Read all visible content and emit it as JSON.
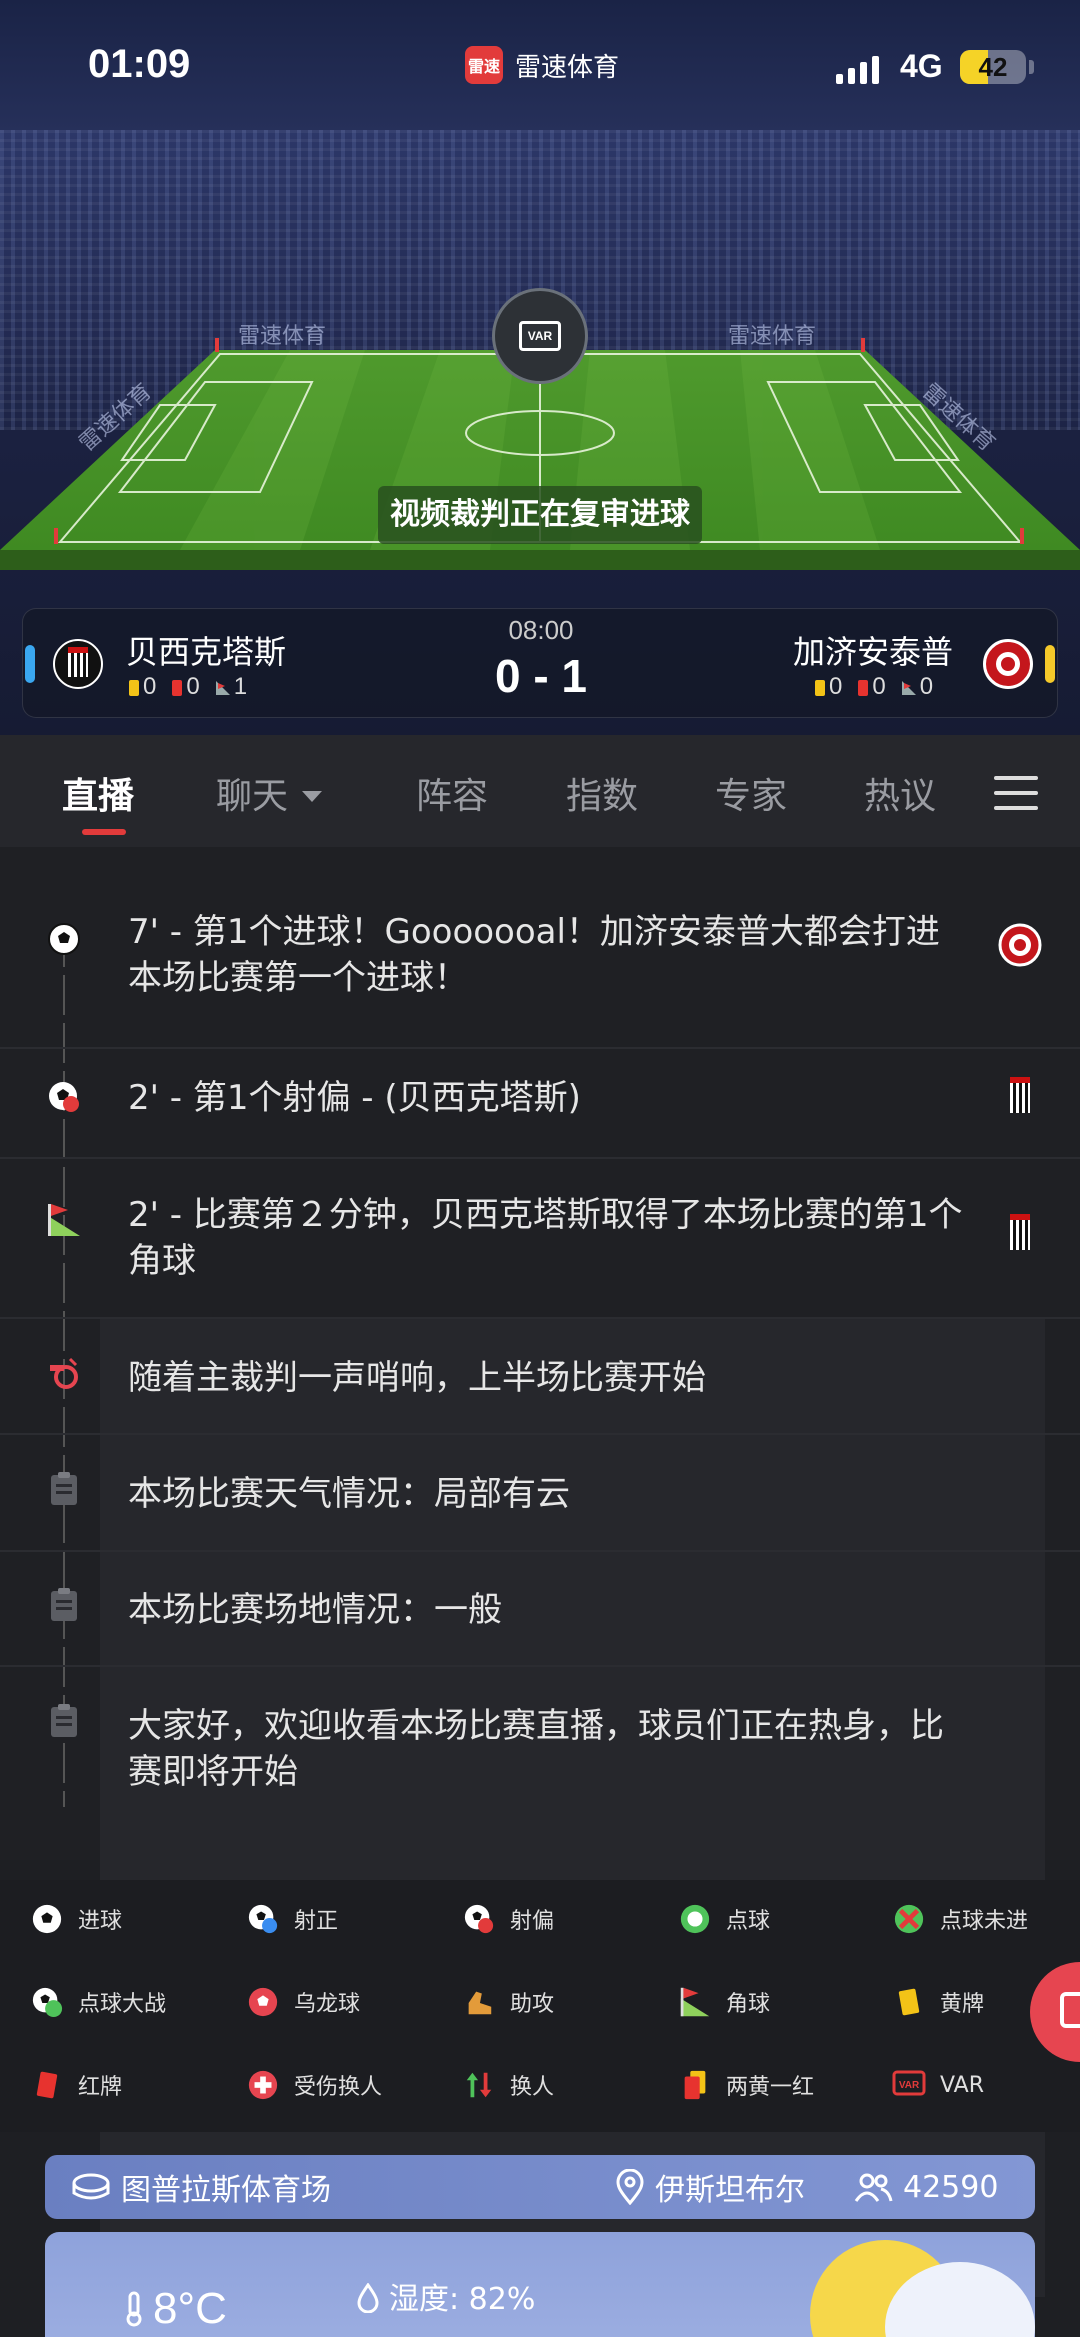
{
  "status": {
    "time": "01:09",
    "app_name": "雷速体育",
    "app_logo": "雷速",
    "network": "4G",
    "battery": "42",
    "battery_level": 0.42
  },
  "stadium": {
    "ad_boards": [
      "雷速体育",
      "雷速体育",
      "雷速体育",
      "雷速体育"
    ],
    "var_label": "VAR",
    "review_text": "视频裁判正在复审进球"
  },
  "match": {
    "time": "08:00",
    "score": "0 - 1",
    "home": {
      "name": "贝西克塔斯",
      "yellow": "0",
      "red": "0",
      "corners": "1",
      "color": "#3aa7f0"
    },
    "away": {
      "name": "加济安泰普",
      "yellow": "0",
      "red": "0",
      "corners": "0",
      "color": "#f5c92a"
    }
  },
  "tabs": [
    {
      "label": "直播",
      "active": true
    },
    {
      "label": "聊天"
    },
    {
      "label": "阵容"
    },
    {
      "label": "指数"
    },
    {
      "label": "专家"
    },
    {
      "label": "热议"
    }
  ],
  "feed": [
    {
      "icon": "ball-icon",
      "text": "7' - 第1个进球！Gooooooal！加济安泰普大都会打进本场比赛第一个进球！",
      "team": "away"
    },
    {
      "icon": "shot-off-target-icon",
      "text": "2' - 第1个射偏 - (贝西克塔斯)",
      "team": "home"
    },
    {
      "icon": "corner-flag-icon",
      "text": "2' - 比赛第２分钟，贝西克塔斯取得了本场比赛的第1个角球",
      "team": "home"
    },
    {
      "icon": "whistle-icon",
      "text": "随着主裁判一声哨响，上半场比赛开始"
    },
    {
      "icon": "clipboard-icon",
      "text": "本场比赛天气情况：局部有云"
    },
    {
      "icon": "clipboard-icon",
      "text": "本场比赛场地情况：一般"
    },
    {
      "icon": "clipboard-icon",
      "text": "大家好，欢迎收看本场比赛直播，球员们正在热身，比赛即将开始"
    }
  ],
  "legend": [
    {
      "icon": "ball-icon",
      "label": "进球"
    },
    {
      "icon": "shot-on-target-icon",
      "label": "射正"
    },
    {
      "icon": "shot-off-target-icon",
      "label": "射偏"
    },
    {
      "icon": "penalty-icon",
      "label": "点球"
    },
    {
      "icon": "penalty-missed-icon",
      "label": "点球未进"
    },
    {
      "icon": "shootout-icon",
      "label": "点球大战"
    },
    {
      "icon": "own-goal-icon",
      "label": "乌龙球"
    },
    {
      "icon": "assist-boot-icon",
      "label": "助攻"
    },
    {
      "icon": "corner-flag-icon",
      "label": "角球"
    },
    {
      "icon": "yellow-card-icon",
      "label": "黄牌"
    },
    {
      "icon": "red-card-icon",
      "label": "红牌"
    },
    {
      "icon": "injury-sub-icon",
      "label": "受伤换人"
    },
    {
      "icon": "substitution-icon",
      "label": "换人"
    },
    {
      "icon": "second-yellow-icon",
      "label": "两黄一红"
    },
    {
      "icon": "var-icon",
      "label": "VAR"
    }
  ],
  "venue": {
    "stadium": "图普拉斯体育场",
    "city": "伊斯坦布尔",
    "capacity": "42590"
  },
  "weather": {
    "temp": "8°C",
    "humidity": "湿度: 82%"
  }
}
